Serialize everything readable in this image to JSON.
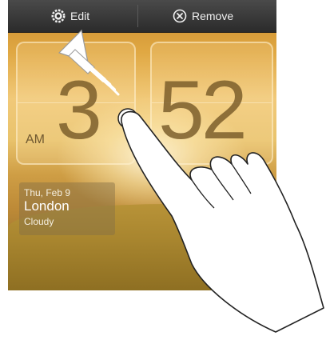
{
  "top_bar": {
    "edit_label": "Edit",
    "remove_label": "Remove"
  },
  "clock": {
    "hour": "3",
    "minute": "52",
    "ampm": "AM"
  },
  "weather": {
    "date": "Thu, Feb 9",
    "city": "London",
    "condition": "Cloudy"
  },
  "icons": {
    "edit": "gear-icon",
    "remove": "close-circle-icon",
    "gesture": "hand-drag-icon",
    "arrow": "drag-arrow-icon"
  },
  "colors": {
    "bar": "#2b2b2b",
    "bar_text": "#f0f0f0",
    "digits": "#785a28"
  }
}
